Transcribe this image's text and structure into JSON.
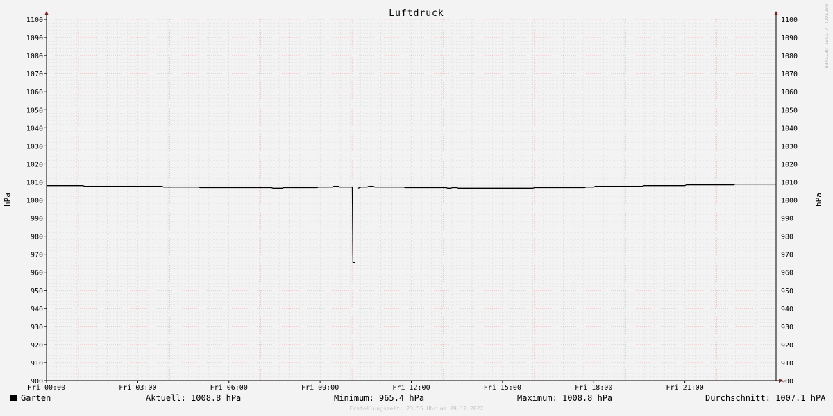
{
  "chart_data": {
    "type": "line",
    "title": "Luftdruck",
    "ylabel_left": "hPa",
    "ylabel_right": "hPa",
    "ylim": [
      900,
      1100
    ],
    "y_ticks": [
      900,
      910,
      920,
      930,
      940,
      950,
      960,
      970,
      980,
      990,
      1000,
      1010,
      1020,
      1030,
      1040,
      1050,
      1060,
      1070,
      1080,
      1090,
      1100
    ],
    "xlim_hours": [
      0,
      24
    ],
    "x_ticks": [
      {
        "hour": 0,
        "label": "Fri 00:00"
      },
      {
        "hour": 3,
        "label": "Fri 03:00"
      },
      {
        "hour": 6,
        "label": "Fri 06:00"
      },
      {
        "hour": 9,
        "label": "Fri 09:00"
      },
      {
        "hour": 12,
        "label": "Fri 12:00"
      },
      {
        "hour": 15,
        "label": "Fri 15:00"
      },
      {
        "hour": 18,
        "label": "Fri 18:00"
      },
      {
        "hour": 21,
        "label": "Fri 21:00"
      }
    ],
    "grid": true,
    "series": [
      {
        "name": "Garten",
        "color": "#000000",
        "points": [
          [
            0.0,
            1008.0
          ],
          [
            1.2,
            1008.0
          ],
          [
            1.25,
            1007.6
          ],
          [
            3.8,
            1007.6
          ],
          [
            3.85,
            1007.2
          ],
          [
            5.0,
            1007.2
          ],
          [
            5.05,
            1006.9
          ],
          [
            7.4,
            1006.9
          ],
          [
            7.45,
            1006.6
          ],
          [
            7.75,
            1006.6
          ],
          [
            7.8,
            1006.9
          ],
          [
            8.9,
            1006.9
          ],
          [
            8.95,
            1007.2
          ],
          [
            9.4,
            1007.2
          ],
          [
            9.45,
            1007.6
          ],
          [
            9.6,
            1007.6
          ],
          [
            9.65,
            1007.2
          ],
          [
            10.06,
            1007.2
          ],
          [
            10.08,
            965.4
          ],
          [
            10.15,
            965.4
          ],
          [
            null,
            null
          ],
          [
            10.25,
            1006.6
          ],
          [
            10.35,
            1007.2
          ],
          [
            10.55,
            1007.2
          ],
          [
            10.6,
            1007.6
          ],
          [
            10.75,
            1007.6
          ],
          [
            10.8,
            1007.2
          ],
          [
            11.75,
            1007.2
          ],
          [
            11.8,
            1006.9
          ],
          [
            13.15,
            1006.9
          ],
          [
            13.2,
            1006.6
          ],
          [
            13.3,
            1006.6
          ],
          [
            13.35,
            1006.9
          ],
          [
            13.5,
            1006.9
          ],
          [
            13.55,
            1006.6
          ],
          [
            16.0,
            1006.6
          ],
          [
            16.05,
            1006.9
          ],
          [
            17.7,
            1006.9
          ],
          [
            17.75,
            1007.2
          ],
          [
            18.0,
            1007.2
          ],
          [
            18.05,
            1007.6
          ],
          [
            19.6,
            1007.6
          ],
          [
            19.65,
            1008.0
          ],
          [
            21.0,
            1008.0
          ],
          [
            21.05,
            1008.4
          ],
          [
            22.6,
            1008.4
          ],
          [
            22.65,
            1008.8
          ],
          [
            24.0,
            1008.8
          ]
        ]
      }
    ]
  },
  "watermark": "RRDTOOL / TOBI OETIKER",
  "legend": {
    "name": "Garten",
    "aktuell": "Aktuell: 1008.8 hPa",
    "minimum": "Minimum: 965.4 hPa",
    "maximum": "Maximum: 1008.8 hPa",
    "durchschnitt": "Durchschnitt: 1007.1 hPA"
  },
  "footer": "Erstellungszeit: 23:55 Uhr am 09.12.2022",
  "colors": {
    "minor_grid": "#dcdcdc",
    "major_grid": "#e8a8a8",
    "axis": "#000000",
    "arrow": "#8b1a1a",
    "line": "#000000"
  }
}
